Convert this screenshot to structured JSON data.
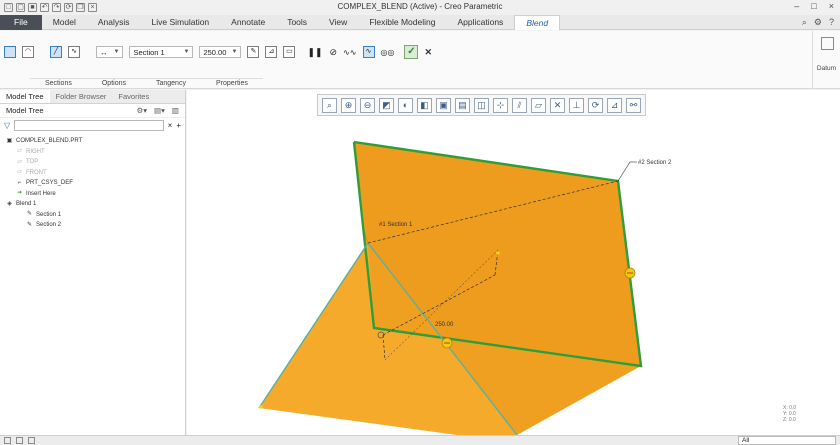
{
  "window": {
    "title": "COMPLEX_BLEND (Active) - Creo Parametric",
    "quick_access": [
      "new",
      "open",
      "save",
      "undo",
      "redo",
      "regen",
      "windows",
      "close"
    ]
  },
  "tabs": [
    {
      "label": "File"
    },
    {
      "label": "Model"
    },
    {
      "label": "Analysis"
    },
    {
      "label": "Live Simulation"
    },
    {
      "label": "Annotate"
    },
    {
      "label": "Tools"
    },
    {
      "label": "View"
    },
    {
      "label": "Flexible Modeling"
    },
    {
      "label": "Applications"
    },
    {
      "label": "Blend"
    }
  ],
  "ribbon": {
    "section_dropdown": "Section 1",
    "depth_value": "250.00",
    "groups": [
      "Sections",
      "Options",
      "Tangency",
      "Properties"
    ],
    "datum_label": "Datum"
  },
  "model_tree": {
    "tabs": [
      "Model Tree",
      "Folder Browser",
      "Favorites"
    ],
    "header": "Model Tree",
    "filter_placeholder": "",
    "items": [
      {
        "label": "COMPLEX_BLEND.PRT",
        "level": 0,
        "icon": "part-icon"
      },
      {
        "label": "RIGHT",
        "level": 1,
        "icon": "datum-plane-icon"
      },
      {
        "label": "TOP",
        "level": 1,
        "icon": "datum-plane-icon"
      },
      {
        "label": "FRONT",
        "level": 1,
        "icon": "datum-plane-icon"
      },
      {
        "label": "PRT_CSYS_DEF",
        "level": 1,
        "icon": "csys-icon"
      },
      {
        "label": "Insert Here",
        "level": 1,
        "icon": "insert-arrow-icon"
      },
      {
        "label": "Blend 1",
        "level": 0,
        "icon": "blend-feature-icon"
      },
      {
        "label": "Section 1",
        "level": 2,
        "icon": "sketch-icon"
      },
      {
        "label": "Section 2",
        "level": 2,
        "icon": "sketch-icon"
      }
    ]
  },
  "viewport": {
    "labels": {
      "section1": "#1 Section 1",
      "section2": "#2 Section 2",
      "depth": "250.00"
    },
    "coords": [
      "X: 0.0",
      "Y: 0.0",
      "Z: 0.0"
    ],
    "colors": {
      "surface": "#f0a020",
      "edge": "#2e9e3a",
      "dim": "#333333",
      "handle": "#f5c518"
    }
  },
  "view_toolbar": [
    "refit-icon",
    "zoom-in-icon",
    "zoom-out-icon",
    "repaint-icon",
    "spin-center-icon",
    "display-style-icon",
    "saved-orientations-icon",
    "view-manager-icon",
    "perspective-icon",
    "plane-display-icon",
    "axis-display-icon",
    "point-display-icon",
    "csys-display-icon",
    "annotation-display-icon",
    "spin-icon",
    "tangent-icon",
    "sketch-view-icon"
  ],
  "status_bar": {
    "filter": "All"
  }
}
